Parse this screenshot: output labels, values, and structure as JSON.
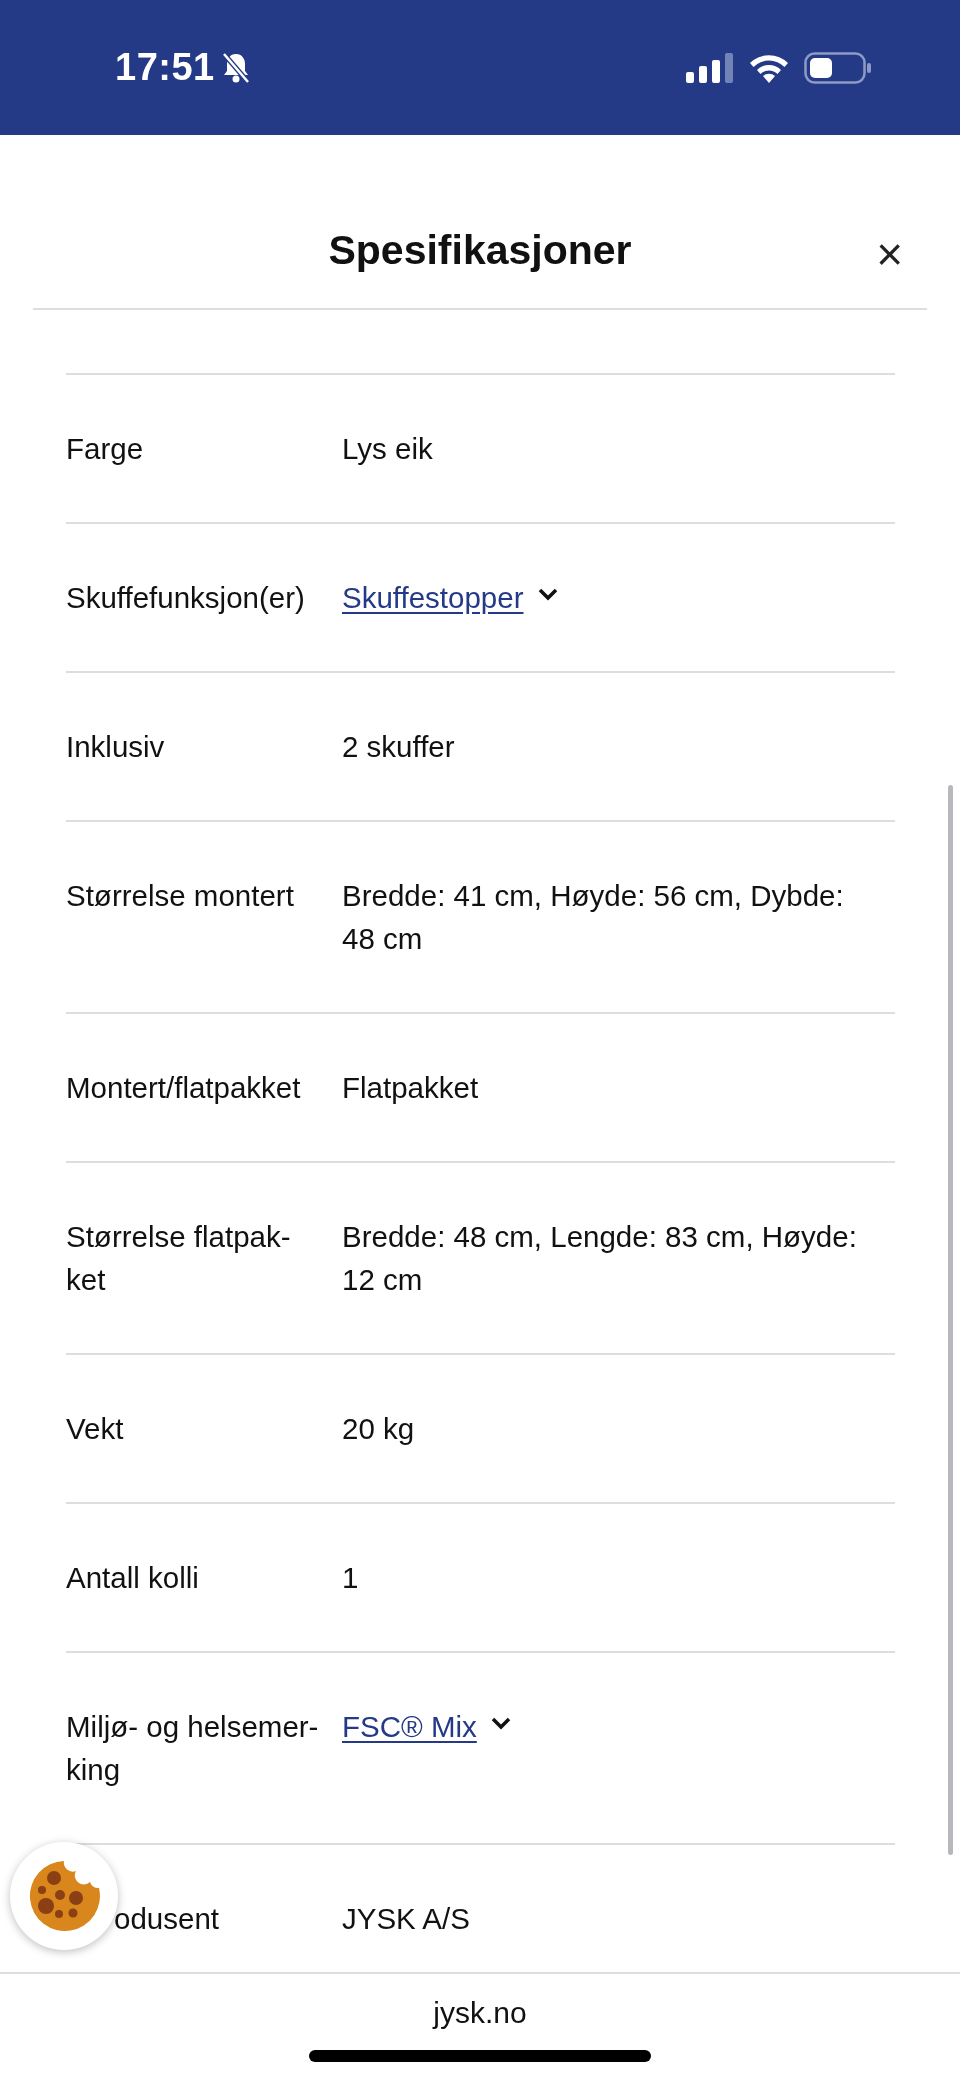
{
  "status_bar": {
    "time": "17:51"
  },
  "sheet": {
    "title": "Spesifikasjoner",
    "close": "×"
  },
  "specs": [
    {
      "label": "Farge",
      "value": "Lys eik",
      "kind": "text"
    },
    {
      "label": "Skuffefunksjon(er)",
      "value": "Skuffestopper",
      "kind": "link"
    },
    {
      "label": "Inklusiv",
      "value": "2 skuffer",
      "kind": "text"
    },
    {
      "label": "Størrelse montert",
      "value": "Bredde: 41 cm, Høyde: 56 cm, Dybde: 48 cm",
      "kind": "text"
    },
    {
      "label": "Montert/flatpakket",
      "value": "Flatpakket",
      "kind": "text"
    },
    {
      "label": "Størrelse flatpak-ket",
      "value": "Bredde: 48 cm, Lengde: 83 cm, Høyde: 12 cm",
      "kind": "text"
    },
    {
      "label": "Vekt",
      "value": "20 kg",
      "kind": "text"
    },
    {
      "label": "Antall kolli",
      "value": "1",
      "kind": "text"
    },
    {
      "label": "Miljø- og helsemer-king",
      "value": "FSC® Mix",
      "kind": "link"
    },
    {
      "label": "odusent",
      "value": "JYSK A/S",
      "kind": "text"
    }
  ],
  "browser_bar": {
    "url": "jysk.no"
  }
}
